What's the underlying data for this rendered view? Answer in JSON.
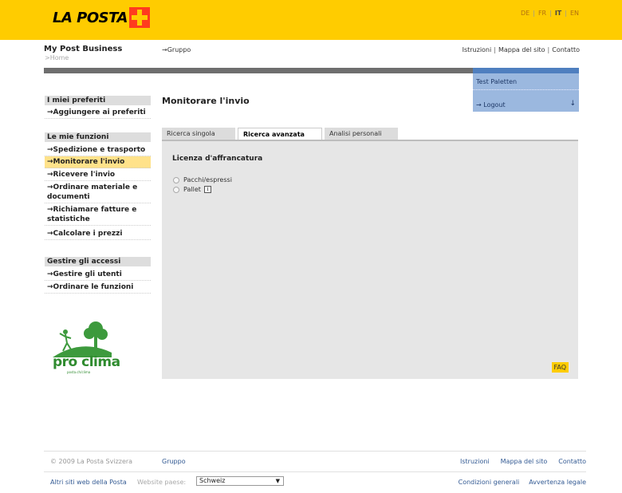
{
  "header": {
    "logo_text": "LA POSTA",
    "languages": [
      {
        "code": "DE",
        "active": false
      },
      {
        "code": "FR",
        "active": false
      },
      {
        "code": "IT",
        "active": true
      },
      {
        "code": "EN",
        "active": false
      }
    ],
    "brand": "My Post Business",
    "breadcrumb": ">Home",
    "gruppo_link": "→Gruppo",
    "top_links": [
      "Istruzioni",
      "Mappa del sito",
      "Contatto"
    ]
  },
  "user": {
    "name": "Test Paletten",
    "logout": "→ Logout",
    "logout_arrow": "↓"
  },
  "sidebar": {
    "favorites_header": "I miei preferiti",
    "favorites_add": "→Aggiungere ai preferiti",
    "functions_header": "Le mie funzioni",
    "functions": [
      {
        "label": "→Spedizione e trasporto",
        "active": false
      },
      {
        "label": "→Monitorare l'invio",
        "active": true
      },
      {
        "label": "→Ricevere l'invio",
        "active": false
      },
      {
        "label": "→Ordinare materiale e documenti",
        "active": false
      },
      {
        "label": "→Richiamare fatture e statistiche",
        "active": false
      },
      {
        "label": "→Calcolare i prezzi",
        "active": false
      }
    ],
    "access_header": "Gestire gli accessi",
    "access": [
      {
        "label": "→Gestire gli utenti"
      },
      {
        "label": "→Ordinare le funzioni"
      }
    ],
    "proclima_text": "pro clima",
    "proclima_url": "posta.ch/clima"
  },
  "main": {
    "title": "Monitorare l'invio",
    "tabs": [
      {
        "label": "Ricerca singola",
        "active": false
      },
      {
        "label": "Ricerca avanzata",
        "active": true
      },
      {
        "label": "Analisi personali",
        "active": false
      }
    ],
    "section_title": "Licenza d'affrancatura",
    "options": [
      {
        "label": "Pacchi/espressi",
        "selected": false
      },
      {
        "label": "Pallet",
        "selected": false
      }
    ],
    "info_icon": "i",
    "faq": "FAQ"
  },
  "footer": {
    "copyright": "© 2009 La Posta Svizzera",
    "gruppo": "Gruppo",
    "links": [
      "Istruzioni",
      "Mappa del sito",
      "Contatto"
    ],
    "other_sites": "Altri siti web della Posta",
    "website_country_label": "Website paese:",
    "country_selected": "Schweiz",
    "legal_links": [
      "Condizioni generali",
      "Avvertenza legale"
    ]
  },
  "colors": {
    "brand_yellow": "#ffcc00",
    "user_box_blue": "#9bb8df",
    "active_highlight": "#ffe28a",
    "link_blue": "#335a93"
  }
}
